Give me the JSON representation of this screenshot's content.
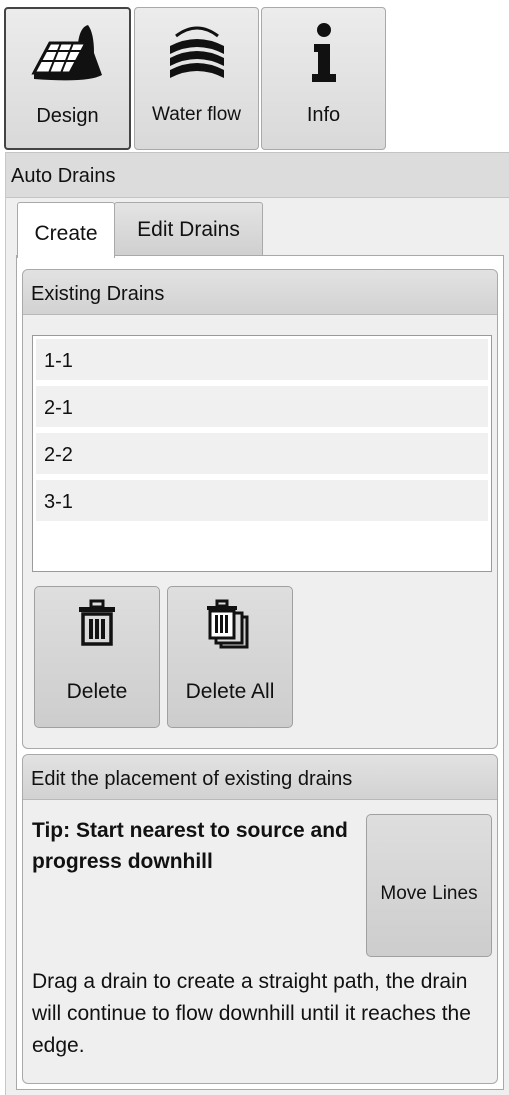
{
  "toolbar": {
    "buttons": [
      {
        "label": "Design",
        "icon": "design-icon"
      },
      {
        "label": "Water flow",
        "icon": "water-flow-icon"
      },
      {
        "label": "Info",
        "icon": "info-icon"
      }
    ]
  },
  "panel": {
    "title": "Auto Drains",
    "tabs": [
      {
        "label": "Create",
        "active": true
      },
      {
        "label": "Edit Drains",
        "active": false
      }
    ],
    "existing": {
      "title": "Existing Drains",
      "items": [
        "1-1",
        "2-1",
        "2-2",
        "3-1"
      ],
      "delete_label": "Delete",
      "delete_all_label": "Delete All"
    },
    "edit": {
      "title": "Edit the placement of existing drains",
      "tip": "Tip: Start nearest to source and progress downhill",
      "move_label": "Move Lines",
      "description": "Drag a drain to create a straight path, the drain will continue to flow downhill until it reaches the edge."
    }
  },
  "colors": {
    "panel_bg": "#efefef",
    "header_bg": "#dcdcdc",
    "button_bg": "#d9d9d9",
    "list_item_bg": "#f0f0f0"
  }
}
